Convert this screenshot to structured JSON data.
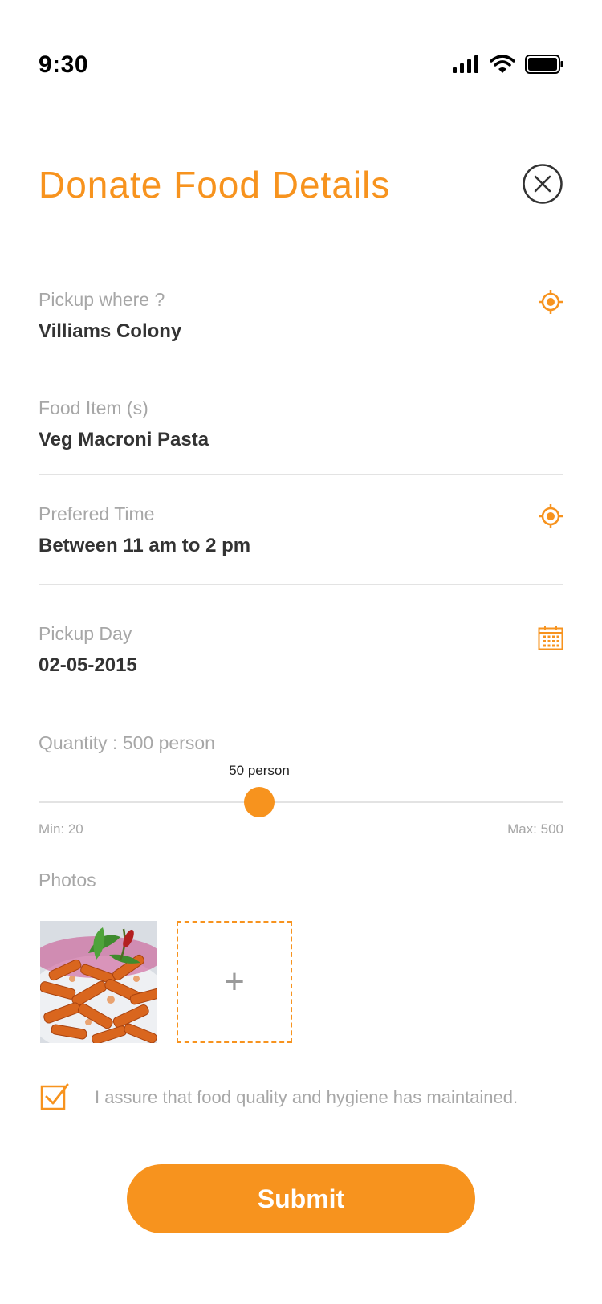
{
  "status_bar": {
    "time": "9:30"
  },
  "header": {
    "title": "Donate Food Details"
  },
  "form": {
    "pickup_where": {
      "label": "Pickup where ?",
      "value": "Villiams Colony",
      "icon": "location-target-icon"
    },
    "food_items": {
      "label": "Food Item (s)",
      "value": "Veg Macroni Pasta"
    },
    "preferred_time": {
      "label": "Prefered Time",
      "value": "Between 11 am to 2 pm",
      "icon": "location-target-icon"
    },
    "pickup_day": {
      "label": "Pickup Day",
      "value": "02-05-2015",
      "icon": "calendar-icon"
    }
  },
  "quantity": {
    "label": "Quantity :  500 person",
    "tooltip": "50 person",
    "min_label": "Min: 20",
    "max_label": "Max: 500",
    "fraction": 0.42
  },
  "photos": {
    "label": "Photos",
    "add_symbol": "+"
  },
  "assurance": {
    "text": "I assure that food quality and hygiene has maintained.",
    "checked": true
  },
  "submit": {
    "label": "Submit"
  },
  "colors": {
    "accent": "#f7931e",
    "label": "#a7a7a7",
    "value": "#333333",
    "divider": "#e3e3e3"
  }
}
